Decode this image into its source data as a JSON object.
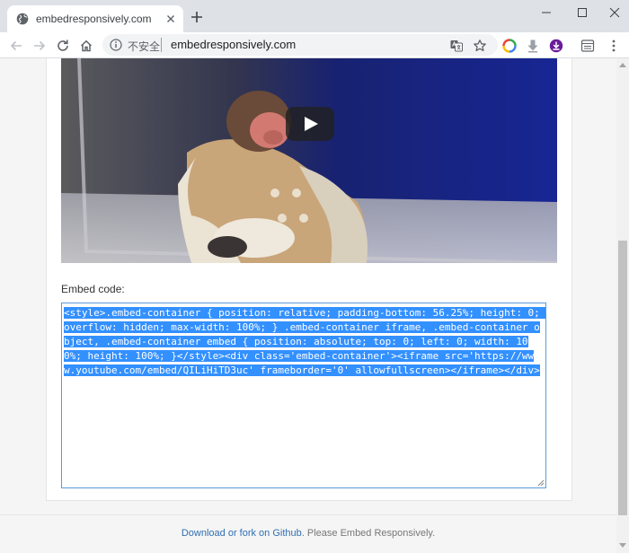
{
  "browser": {
    "tab": {
      "title": "embedresponsively.com"
    },
    "omnibox": {
      "security_label": "不安全",
      "url": "embedresponsively.com"
    }
  },
  "page": {
    "embed_label": "Embed code:",
    "embed_code": "<style>.embed-container { position: relative; padding-bottom: 56.25%; height: 0; overflow: hidden; max-width: 100%; } .embed-container iframe, .embed-container object, .embed-container embed { position: absolute; top: 0; left: 0; width: 100%; height: 100%; }</style><div class='embed-container'><iframe src='https://www.youtube.com/embed/QILiHiTD3uc' frameborder='0' allowfullscreen></iframe></div>",
    "footer": {
      "link_text": "Download or fork on Github",
      "rest_text": ". Please Embed Responsively."
    }
  },
  "colors": {
    "tabbar_bg": "#dee1e6",
    "selection": "#3390ff",
    "link": "#2f6fb1",
    "extension_purple": "#6a1b9a"
  },
  "icons": [
    "globe-icon",
    "close-icon",
    "plus-icon",
    "minimize-icon",
    "maximize-icon",
    "back-icon",
    "forward-icon",
    "reload-icon",
    "home-icon",
    "info-icon",
    "translate-icon",
    "star-icon",
    "extension-icon",
    "download-icon",
    "menu-icon",
    "play-icon"
  ]
}
